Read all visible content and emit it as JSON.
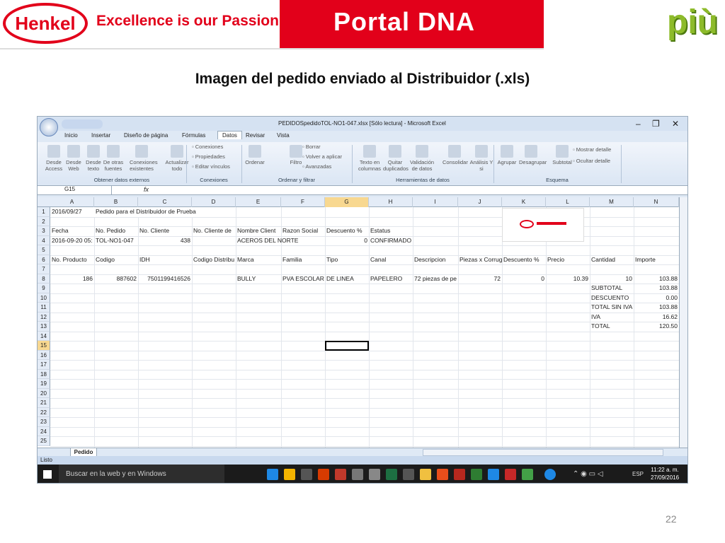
{
  "header": {
    "brand": "Henkel",
    "tagline": "Excellence is our Passion",
    "portal": "Portal  DNA",
    "piu": "più"
  },
  "slide": {
    "title": "Imagen del pedido enviado al Distribuidor (.xls)",
    "number": "22"
  },
  "excel": {
    "window_title": "PEDIDOSpedidoTOL-NO1-047.xlsx [Sólo lectura] - Microsoft Excel",
    "tabs": [
      "Inicio",
      "Insertar",
      "Diseño de página",
      "Fórmulas",
      "Datos",
      "Revisar",
      "Vista"
    ],
    "active_tab": "Datos",
    "ribbon_buttons": [
      {
        "label": "Desde Access"
      },
      {
        "label": "Desde Web"
      },
      {
        "label": "Desde texto"
      },
      {
        "label": "De otras fuentes"
      },
      {
        "label": "Conexiones existentes"
      },
      {
        "label": "Actualizar todo"
      },
      {
        "label": "Conexiones"
      },
      {
        "label": "Propiedades"
      },
      {
        "label": "Editar vínculos"
      },
      {
        "label": "Ordenar"
      },
      {
        "label": "Filtro"
      },
      {
        "label": "Borrar"
      },
      {
        "label": "Volver a aplicar"
      },
      {
        "label": "Avanzadas"
      },
      {
        "label": "Texto en columnas"
      },
      {
        "label": "Quitar duplicados"
      },
      {
        "label": "Validación de datos"
      },
      {
        "label": "Consolidar"
      },
      {
        "label": "Análisis Y si"
      },
      {
        "label": "Agrupar"
      },
      {
        "label": "Desagrupar"
      },
      {
        "label": "Subtotal"
      },
      {
        "label": "Mostrar detalle"
      },
      {
        "label": "Ocultar detalle"
      }
    ],
    "ribbon_groups": [
      "Obtener datos externos",
      "Conexiones",
      "Ordenar y filtrar",
      "Herramientas de datos",
      "Esquema"
    ],
    "name_box": "G15",
    "fx": "fx",
    "columns": [
      "A",
      "B",
      "C",
      "D",
      "E",
      "F",
      "G",
      "H",
      "I",
      "J",
      "K",
      "L",
      "M",
      "N"
    ],
    "rows": [
      "1",
      "2",
      "3",
      "4",
      "5",
      "6",
      "7",
      "8",
      "9",
      "10",
      "11",
      "12",
      "13",
      "14",
      "15",
      "16",
      "17",
      "18",
      "19",
      "20",
      "21",
      "22",
      "23",
      "24",
      "25"
    ],
    "cells": [
      {
        "r": 0,
        "c": 0,
        "v": "2016/09/27"
      },
      {
        "r": 0,
        "c": 1,
        "v": "Pedido para el Distribuidor de Prueba"
      },
      {
        "r": 2,
        "c": 0,
        "v": "Fecha"
      },
      {
        "r": 2,
        "c": 1,
        "v": "No. Pedido"
      },
      {
        "r": 2,
        "c": 2,
        "v": "No. Cliente"
      },
      {
        "r": 2,
        "c": 3,
        "v": "No. Cliente de"
      },
      {
        "r": 2,
        "c": 4,
        "v": "Nombre Client"
      },
      {
        "r": 2,
        "c": 5,
        "v": "Razon Social"
      },
      {
        "r": 2,
        "c": 6,
        "v": "Descuento %"
      },
      {
        "r": 2,
        "c": 7,
        "v": "Estatus"
      },
      {
        "r": 3,
        "c": 0,
        "v": "2016-09-20 05:"
      },
      {
        "r": 3,
        "c": 1,
        "v": "TOL-NO1-047"
      },
      {
        "r": 3,
        "c": 2,
        "v": "438",
        "a": "r"
      },
      {
        "r": 3,
        "c": 4,
        "v": "ACEROS DEL NORTE"
      },
      {
        "r": 3,
        "c": 6,
        "v": "0",
        "a": "r"
      },
      {
        "r": 3,
        "c": 7,
        "v": "CONFIRMADO"
      },
      {
        "r": 5,
        "c": 0,
        "v": "No. Producto"
      },
      {
        "r": 5,
        "c": 1,
        "v": "Codigo"
      },
      {
        "r": 5,
        "c": 2,
        "v": "IDH"
      },
      {
        "r": 5,
        "c": 3,
        "v": "Codigo Distribu"
      },
      {
        "r": 5,
        "c": 4,
        "v": "Marca"
      },
      {
        "r": 5,
        "c": 5,
        "v": "Familia"
      },
      {
        "r": 5,
        "c": 6,
        "v": "Tipo"
      },
      {
        "r": 5,
        "c": 7,
        "v": "Canal"
      },
      {
        "r": 5,
        "c": 8,
        "v": "Descripcion"
      },
      {
        "r": 5,
        "c": 9,
        "v": "Piezas x Corrug"
      },
      {
        "r": 5,
        "c": 10,
        "v": "Descuento %"
      },
      {
        "r": 5,
        "c": 11,
        "v": "Precio"
      },
      {
        "r": 5,
        "c": 12,
        "v": "Cantidad"
      },
      {
        "r": 5,
        "c": 13,
        "v": "Importe"
      },
      {
        "r": 7,
        "c": 0,
        "v": "186",
        "a": "r"
      },
      {
        "r": 7,
        "c": 1,
        "v": "887602",
        "a": "r"
      },
      {
        "r": 7,
        "c": 2,
        "v": "7501199416526",
        "a": "r"
      },
      {
        "r": 7,
        "c": 4,
        "v": "BULLY"
      },
      {
        "r": 7,
        "c": 5,
        "v": "PVA ESCOLAR"
      },
      {
        "r": 7,
        "c": 6,
        "v": "DE LINEA"
      },
      {
        "r": 7,
        "c": 7,
        "v": "PAPELERO"
      },
      {
        "r": 7,
        "c": 8,
        "v": "72 piezas de pe"
      },
      {
        "r": 7,
        "c": 9,
        "v": "72",
        "a": "r"
      },
      {
        "r": 7,
        "c": 10,
        "v": "0",
        "a": "r"
      },
      {
        "r": 7,
        "c": 11,
        "v": "10.39",
        "a": "r"
      },
      {
        "r": 7,
        "c": 12,
        "v": "10",
        "a": "r"
      },
      {
        "r": 7,
        "c": 13,
        "v": "103.88",
        "a": "r"
      },
      {
        "r": 8,
        "c": 12,
        "v": "SUBTOTAL"
      },
      {
        "r": 8,
        "c": 13,
        "v": "103.88",
        "a": "r"
      },
      {
        "r": 9,
        "c": 12,
        "v": "DESCUENTO"
      },
      {
        "r": 9,
        "c": 13,
        "v": "0.00",
        "a": "r"
      },
      {
        "r": 10,
        "c": 12,
        "v": "TOTAL SIN IVA"
      },
      {
        "r": 10,
        "c": 13,
        "v": "103.88",
        "a": "r"
      },
      {
        "r": 11,
        "c": 12,
        "v": "IVA"
      },
      {
        "r": 11,
        "c": 13,
        "v": "16.62",
        "a": "r"
      },
      {
        "r": 12,
        "c": 12,
        "v": "TOTAL"
      },
      {
        "r": 12,
        "c": 13,
        "v": "120.50",
        "a": "r"
      }
    ],
    "sheet_tab": "Pedido",
    "status": "Listo"
  },
  "taskbar": {
    "search_placeholder": "Buscar en la web y en Windows",
    "lang": "ESP",
    "time": "11:22 a. m.",
    "date": "27/09/2016"
  },
  "colors": {
    "henkel_red": "#e2001a",
    "piu_green": "#8dbb2a"
  }
}
